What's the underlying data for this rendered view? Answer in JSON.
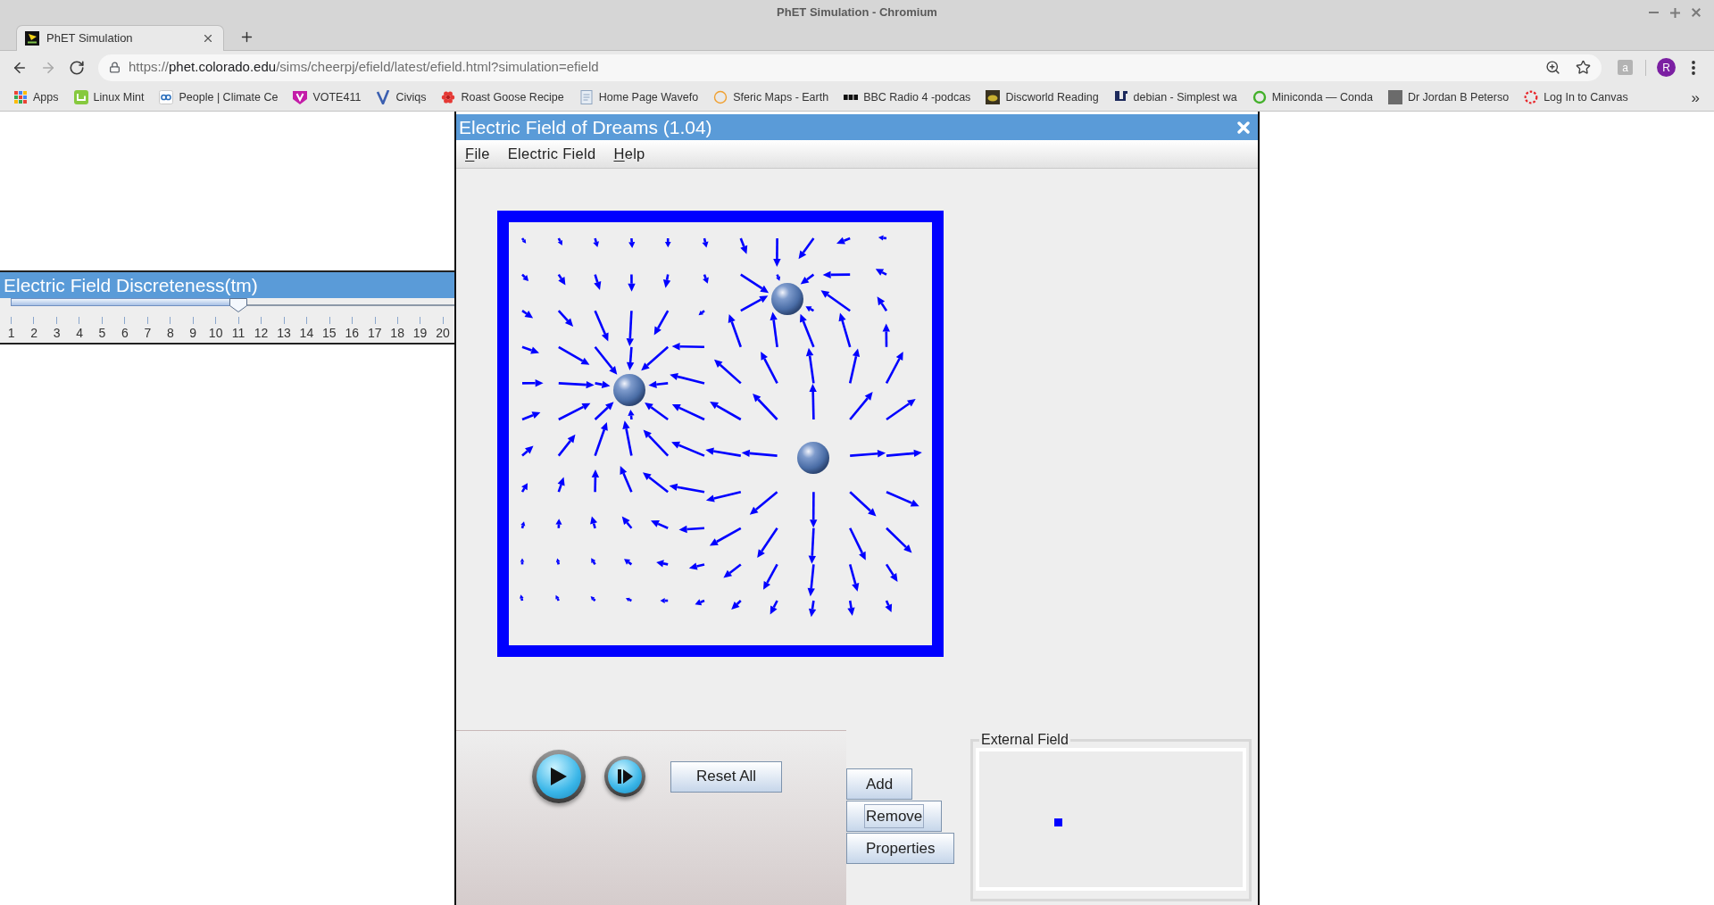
{
  "window": {
    "title": "PhET Simulation - Chromium"
  },
  "tabs": [
    {
      "title": "PhET Simulation",
      "selected": true
    }
  ],
  "toolbar": {
    "nav": [
      {
        "kind": "back",
        "disabled": false
      },
      {
        "kind": "forward",
        "disabled": true
      },
      {
        "kind": "reload",
        "disabled": false
      }
    ],
    "url": {
      "scheme": "https://",
      "host": "phet.colorado.edu",
      "path": "/sims/cheerpj/efield/latest/efield.html?simulation=efield"
    },
    "extension_label": "a",
    "profile_initial": "R"
  },
  "bookmarks_bar": {
    "items": [
      {
        "label": "Apps"
      },
      {
        "label": "Linux Mint"
      },
      {
        "label": "People | Climate Ce"
      },
      {
        "label": "VOTE411"
      },
      {
        "label": "Civiqs"
      },
      {
        "label": "Roast Goose Recipe"
      },
      {
        "label": "Home Page Wavefo"
      },
      {
        "label": "Sferic Maps - Earth"
      },
      {
        "label": "BBC Radio 4 -podcas"
      },
      {
        "label": "Discworld Reading"
      },
      {
        "label": "debian - Simplest wa"
      },
      {
        "label": "Miniconda — Conda"
      },
      {
        "label": "Dr Jordan B Peterso"
      },
      {
        "label": "Log In to Canvas"
      }
    ],
    "overflow": "»"
  },
  "discreteness_panel": {
    "title": "Electric Field Discreteness(tm)",
    "slider": {
      "level": 0.526,
      "tick_labels": "1 2 3 4 5 6 7 8 9 10 11 12 13 14 15 16 17 18 19 20"
    }
  },
  "simulation": {
    "title": "Electric Field of Dreams (1.04)",
    "menus": [
      {
        "label": "File",
        "mnemonic": true
      },
      {
        "label": "Electric Field",
        "mnemonic": false
      },
      {
        "label": "Help",
        "mnemonic": true
      }
    ],
    "reset_button": "Reset All",
    "charge_buttons": [
      {
        "label": "Add",
        "focused": false
      },
      {
        "label": "Remove",
        "focused": true
      },
      {
        "label": "Properties",
        "focused": false
      }
    ],
    "external_field": {
      "title": "External Field"
    }
  }
}
